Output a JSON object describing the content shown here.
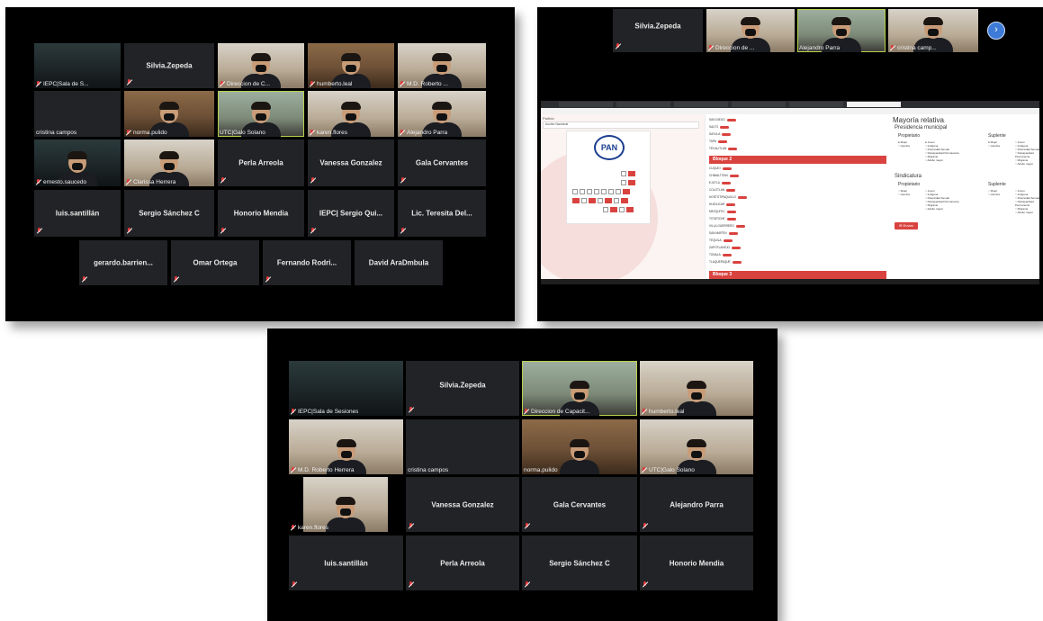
{
  "screenshot_a": {
    "tiles": [
      {
        "name": "IEPC|Sala de S...",
        "type": "video"
      },
      {
        "name": "Silvia.Zepeda",
        "type": "name"
      },
      {
        "name": "Direccion de C...",
        "type": "video"
      },
      {
        "name": "humberto.leal",
        "type": "video"
      },
      {
        "name": "M.D. Roberto ...",
        "type": "video"
      },
      {
        "name": "cristina campos",
        "type": "dark"
      },
      {
        "name": "norma.pulido",
        "type": "video"
      },
      {
        "name": "UTC|Galo Solano",
        "type": "video"
      },
      {
        "name": "karen.flores",
        "type": "video"
      },
      {
        "name": "Alejandro Parra",
        "type": "video"
      },
      {
        "name": "ernesto.saucedo",
        "type": "video"
      },
      {
        "name": "Clarissa Herrera",
        "type": "video"
      },
      {
        "name": "Perla Arreola",
        "type": "name"
      },
      {
        "name": "Vanessa Gonzalez",
        "type": "name"
      },
      {
        "name": "Gala Cervantes",
        "type": "name"
      },
      {
        "name": "luis.santillán",
        "type": "name"
      },
      {
        "name": "Sergio Sánchez C",
        "type": "name"
      },
      {
        "name": "Honorio Mendia",
        "type": "name"
      },
      {
        "name": "IEPC| Sergio Qui...",
        "type": "name"
      },
      {
        "name": "Lic. Teresita Del...",
        "type": "name"
      },
      {
        "name": "gerardo.barrien...",
        "type": "name"
      },
      {
        "name": "Omar Ortega",
        "type": "name"
      },
      {
        "name": "Fernando Rodri...",
        "type": "name"
      },
      {
        "name": "David AraDmbula",
        "type": "name"
      }
    ]
  },
  "screenshot_b": {
    "strip": [
      {
        "name": "Silvia.Zepeda",
        "type": "name"
      },
      {
        "name": "Direccion de ...",
        "type": "video"
      },
      {
        "name": "Alejandro Parra",
        "type": "video"
      },
      {
        "name": "cristina camp...",
        "type": "video"
      }
    ],
    "share": {
      "party_label": "Partido",
      "party_value": "Acción Nacional",
      "party_logo": "PAN",
      "bloque2": "Bloque 2",
      "bloque3": "Bloque 3",
      "title": "Mayoría relativa",
      "section1": "Presidencia municipal",
      "section2": "Sindicatura",
      "propietario": "Propietario",
      "suplente": "Suplente",
      "send_button": "Enviar",
      "mujer": "Mujer",
      "hombre": "Hombre",
      "joven": "Joven",
      "indigena": "Indígena",
      "diversidad": "Diversidad Sexual",
      "discapacidad": "Discapacidad Permanente",
      "migrante": "Migrante",
      "adulto": "Adulto mayor"
    }
  },
  "screenshot_c": {
    "tiles": [
      {
        "name": "IEPC|Sala de Sesiones",
        "type": "video"
      },
      {
        "name": "Silvia.Zepeda",
        "type": "name"
      },
      {
        "name": "Direccion de Capacit...",
        "type": "video"
      },
      {
        "name": "humberto.leal",
        "type": "video"
      },
      {
        "name": "M.D. Roberto Herrera",
        "type": "video"
      },
      {
        "name": "cristina campos",
        "type": "dark"
      },
      {
        "name": "norma.pulido",
        "type": "video"
      },
      {
        "name": "UTC|Galo Solano",
        "type": "video"
      },
      {
        "name": "karen.flores",
        "type": "video"
      },
      {
        "name": "Vanessa Gonzalez",
        "type": "name"
      },
      {
        "name": "Gala Cervantes",
        "type": "name"
      },
      {
        "name": "Alejandro Parra",
        "type": "name"
      },
      {
        "name": "luis.santillán",
        "type": "name"
      },
      {
        "name": "Perla Arreola",
        "type": "name"
      },
      {
        "name": "Sergio Sánchez C",
        "type": "name"
      },
      {
        "name": "Honorio Mendia",
        "type": "name"
      }
    ]
  },
  "colors": {
    "active_speaker": "#b8d14a",
    "accent_red": "#d9433f",
    "pan_blue": "#1a3d8f"
  },
  "icons": [
    "muted-mic-icon",
    "next-page-arrow-icon"
  ]
}
